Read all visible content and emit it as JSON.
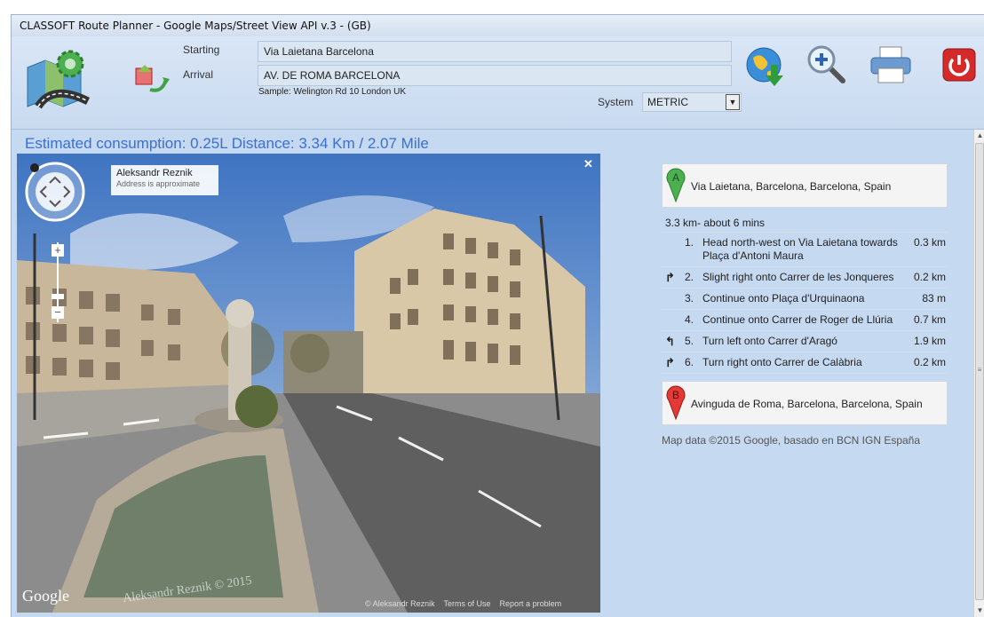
{
  "window": {
    "title": "CLASSOFT Route Planner - Google Maps/Street View API v.3 - (GB)"
  },
  "form": {
    "starting_label": "Starting",
    "starting_value": "Via Laietana Barcelona",
    "arrival_label": "Arrival",
    "arrival_value": "AV. DE ROMA BARCELONA",
    "sample_hint": "Sample: Welington Rd 10 London UK",
    "system_label": "System",
    "system_value": "METRIC"
  },
  "toolbar": {
    "icons": [
      "app-logo-icon",
      "swap-route-icon",
      "globe-download-icon",
      "zoom-in-icon",
      "printer-icon",
      "power-icon"
    ]
  },
  "main": {
    "consumption_text": "Estimated consumption: 0.25L Distance: 3.34 Km / 2.07 Mile"
  },
  "streetview": {
    "author": "Aleksandr Reznik",
    "address_note": "Address is approximate",
    "close_symbol": "✕",
    "zoom_in": "+",
    "zoom_out": "−",
    "google_logo": "Google",
    "footer_author": "© Aleksandr Reznik",
    "footer_terms": "Terms of Use",
    "footer_report": "Report a problem",
    "watermark": "Aleksandr Reznik © 2015"
  },
  "directions": {
    "start_marker": "A",
    "start_address": "Via Laietana, Barcelona, Barcelona, Spain",
    "summary": "3.3 km- about 6 mins",
    "steps": [
      {
        "turn": "",
        "num": "1.",
        "text": "Head north-west on Via Laietana towards Plaça d'Antoni Maura",
        "dist": "0.3 km"
      },
      {
        "turn": "↱",
        "num": "2.",
        "text": "Slight right onto Carrer de les Jonqueres",
        "dist": "0.2 km"
      },
      {
        "turn": "",
        "num": "3.",
        "text": "Continue onto Plaça d'Urquinaona",
        "dist": "83 m"
      },
      {
        "turn": "",
        "num": "4.",
        "text": "Continue onto Carrer de Roger de Llúria",
        "dist": "0.7 km"
      },
      {
        "turn": "↰",
        "num": "5.",
        "text": "Turn left onto Carrer d'Aragó",
        "dist": "1.9 km"
      },
      {
        "turn": "↱",
        "num": "6.",
        "text": "Turn right onto Carrer de Calàbria",
        "dist": "0.2 km"
      }
    ],
    "end_marker": "B",
    "end_address": "Avinguda de Roma, Barcelona, Barcelona, Spain",
    "map_data": "Map data ©2015 Google, basado en BCN IGN España"
  },
  "scrollbar": {
    "up": "▲",
    "down": "▼",
    "grip": "≡"
  }
}
